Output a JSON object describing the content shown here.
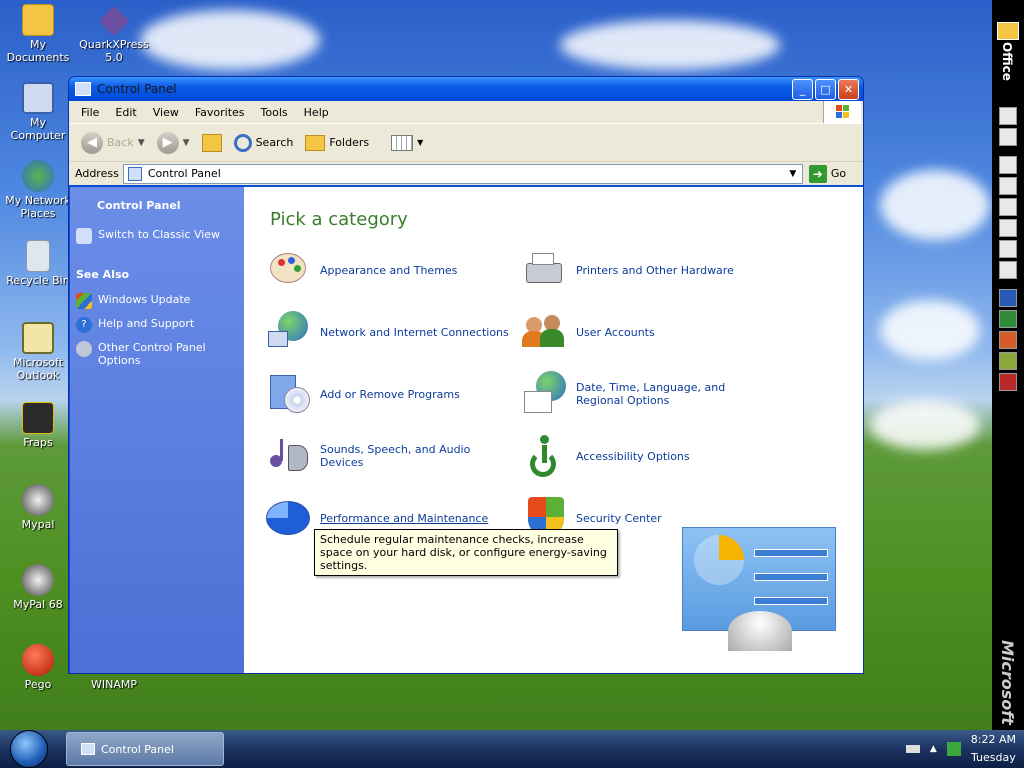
{
  "desktop": {
    "icons": [
      {
        "label": "My\nDocuments",
        "icon": "folder-icon"
      },
      {
        "label": "QuarkXPress\n5.0",
        "icon": "quarkxpress-icon"
      },
      {
        "label": "My Computer",
        "icon": "computer-icon"
      },
      {
        "label": "My Network\nPlaces",
        "icon": "network-icon"
      },
      {
        "label": "Recycle Bin",
        "icon": "recycle-bin-icon"
      },
      {
        "label": "Microsoft\nOutlook",
        "icon": "outlook-icon"
      },
      {
        "label": "Fraps",
        "icon": "fraps-icon"
      },
      {
        "label": "Mypal",
        "icon": "mypal-icon"
      },
      {
        "label": "MyPal 68",
        "icon": "mypal68-icon"
      },
      {
        "label": "Pego",
        "icon": "pego-icon"
      },
      {
        "label": "WINAMP",
        "icon": "winamp-icon"
      }
    ]
  },
  "officebar": {
    "title": "Office",
    "brand": "Microsoft"
  },
  "window": {
    "title": "Control Panel",
    "menu": [
      "File",
      "Edit",
      "View",
      "Favorites",
      "Tools",
      "Help"
    ],
    "toolbar": {
      "back": "Back",
      "search": "Search",
      "folders": "Folders"
    },
    "address": {
      "label": "Address",
      "value": "Control Panel",
      "go": "Go"
    },
    "sidebar": {
      "panel_title": "Control Panel",
      "switch_view": "Switch to Classic View",
      "see_also_title": "See Also",
      "see_also": [
        "Windows Update",
        "Help and Support",
        "Other Control Panel Options"
      ]
    },
    "main": {
      "heading": "Pick a category",
      "categories": [
        "Appearance and Themes",
        "Printers and Other Hardware",
        "Network and Internet Connections",
        "User Accounts",
        "Add or Remove Programs",
        "Date, Time, Language, and Regional Options",
        "Sounds, Speech, and Audio Devices",
        "Accessibility Options",
        "Performance and Maintenance",
        "Security Center"
      ],
      "tooltip": "Schedule regular maintenance checks, increase space on your hard disk, or configure energy-saving settings."
    }
  },
  "taskbar": {
    "task": "Control Panel",
    "time": "8:22 AM",
    "day": "Tuesday"
  },
  "colors": {
    "accent_heading": "#3a7d2c",
    "link": "#0c3c9c",
    "tooltip_bg": "#ffffe1",
    "sidebar": "#5a7ddf"
  }
}
